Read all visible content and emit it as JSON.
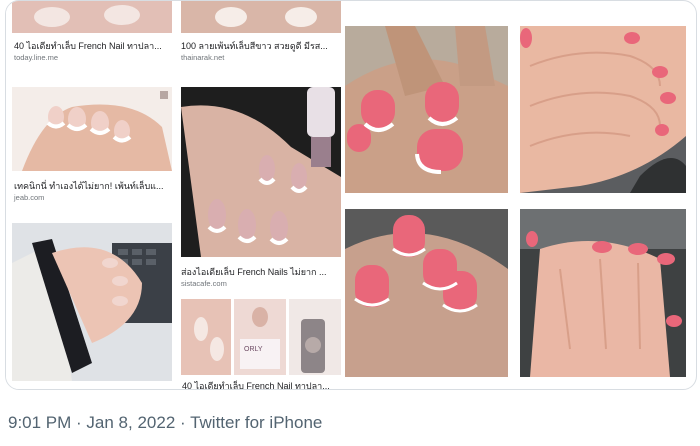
{
  "results": [
    {
      "caption": "40 ไอเดียทำเล็บ French Nail ทาปลา...",
      "source": "today.line.me"
    },
    {
      "caption": "100 ลายเพ้นท์เล็บสีขาว สวยดูดี มีรส...",
      "source": "thainarak.net"
    },
    {
      "caption": "เทคนิกนี่ ทำเองได้ไม่ยาก! เพ้นท์เล็บแ...",
      "source": "jeab.com"
    },
    {
      "caption": "ส่องไอเดียเล็บ French Nails ไม่ยาก ...",
      "source": "sistacafe.com"
    },
    {
      "caption": "40 ไอเดียทำเล็บ French Nail ทาปลา...",
      "source": ""
    }
  ],
  "tweet_meta": "9:01 PM · Jan 8, 2022 · Twitter for iPhone",
  "colors": {
    "meta_text": "#536471",
    "border": "#d8dde2",
    "nail_pink": "#e9677a"
  }
}
